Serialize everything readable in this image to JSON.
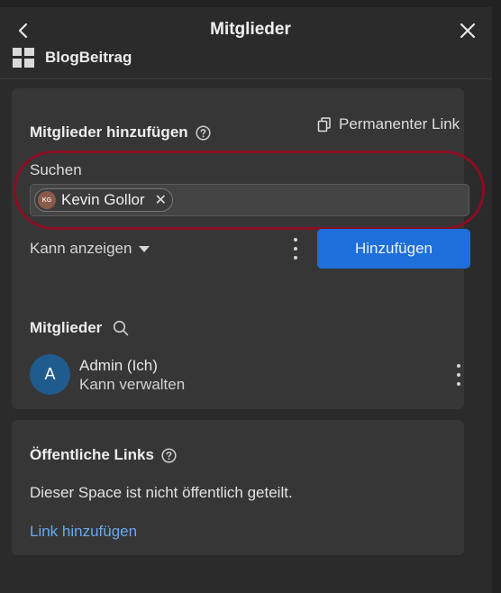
{
  "header": {
    "title": "Mitglieder",
    "back_icon": "chevron-left-icon",
    "close_icon": "close-icon"
  },
  "document": {
    "icon": "grid-icon",
    "title": "BlogBeitrag"
  },
  "add_members": {
    "title": "Mitglieder hinzufügen",
    "permanent_link": "Permanenter Link",
    "search_label": "Suchen",
    "chips": [
      {
        "initials": "KG",
        "name": "Kevin Gollor"
      }
    ],
    "permission": "Kann anzeigen",
    "add_button": "Hinzufügen"
  },
  "members": {
    "title": "Mitglieder",
    "list": [
      {
        "initial": "A",
        "name": "Admin (Ich)",
        "role": "Kann verwalten"
      }
    ]
  },
  "public_links": {
    "title": "Öffentliche Links",
    "message": "Dieser Space ist nicht öffentlich geteilt.",
    "add_link": "Link hinzufügen"
  },
  "colors": {
    "accent": "#1e6fd9",
    "link": "#6aa8f0",
    "highlight": "#8a0d22"
  }
}
